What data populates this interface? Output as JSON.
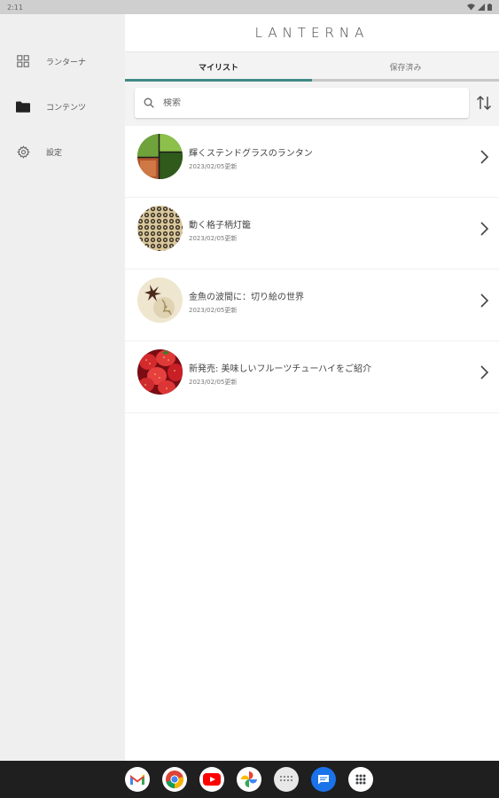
{
  "status_bar": {
    "time": "2:11"
  },
  "sidebar": {
    "items": [
      {
        "label": "ランターナ",
        "icon": "grid-icon"
      },
      {
        "label": "コンテンツ",
        "icon": "folder-icon"
      },
      {
        "label": "設定",
        "icon": "gear-icon"
      }
    ]
  },
  "header": {
    "title": "LANTERNA"
  },
  "tabs": [
    {
      "label": "マイリスト",
      "active": true
    },
    {
      "label": "保存済み",
      "active": false
    }
  ],
  "search": {
    "placeholder": "検索",
    "value": ""
  },
  "items": [
    {
      "title": "輝くステンドグラスのランタン",
      "date": "2023/02/05更新",
      "thumb": "stained-glass"
    },
    {
      "title": "動く格子柄灯籠",
      "date": "2023/02/05更新",
      "thumb": "lattice"
    },
    {
      "title": "金魚の波間に：切り絵の世界",
      "date": "2023/02/05更新",
      "thumb": "papercut"
    },
    {
      "title": "新発売: 美味しいフルーツチューハイをご紹介",
      "date": "2023/02/05更新",
      "thumb": "strawberries"
    }
  ],
  "dock": [
    "gmail-icon",
    "chrome-icon",
    "youtube-icon",
    "photos-icon",
    "keyboard-app-icon",
    "messages-icon",
    "app-drawer-icon"
  ],
  "colors": {
    "accent": "#3f8a84",
    "sidebar_bg": "#efefef",
    "nav_bar_bg": "#1f1f1f"
  }
}
